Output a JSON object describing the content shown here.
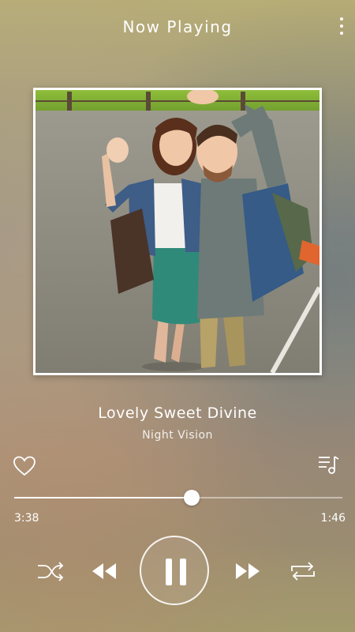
{
  "header": {
    "title": "Now Playing"
  },
  "track": {
    "title": "Lovely Sweet Divine",
    "artist": "Night Vision"
  },
  "progress": {
    "elapsed": "3:38",
    "total": "1:46",
    "fraction": 0.54
  },
  "icons": {
    "more": "more-vertical-icon",
    "favorite": "heart-outline-icon",
    "queue": "playlist-icon",
    "shuffle": "shuffle-icon",
    "previous": "rewind-icon",
    "play_pause": "pause-icon",
    "next": "fast-forward-icon",
    "repeat": "repeat-icon"
  },
  "colors": {
    "accent": "#ffffff"
  }
}
